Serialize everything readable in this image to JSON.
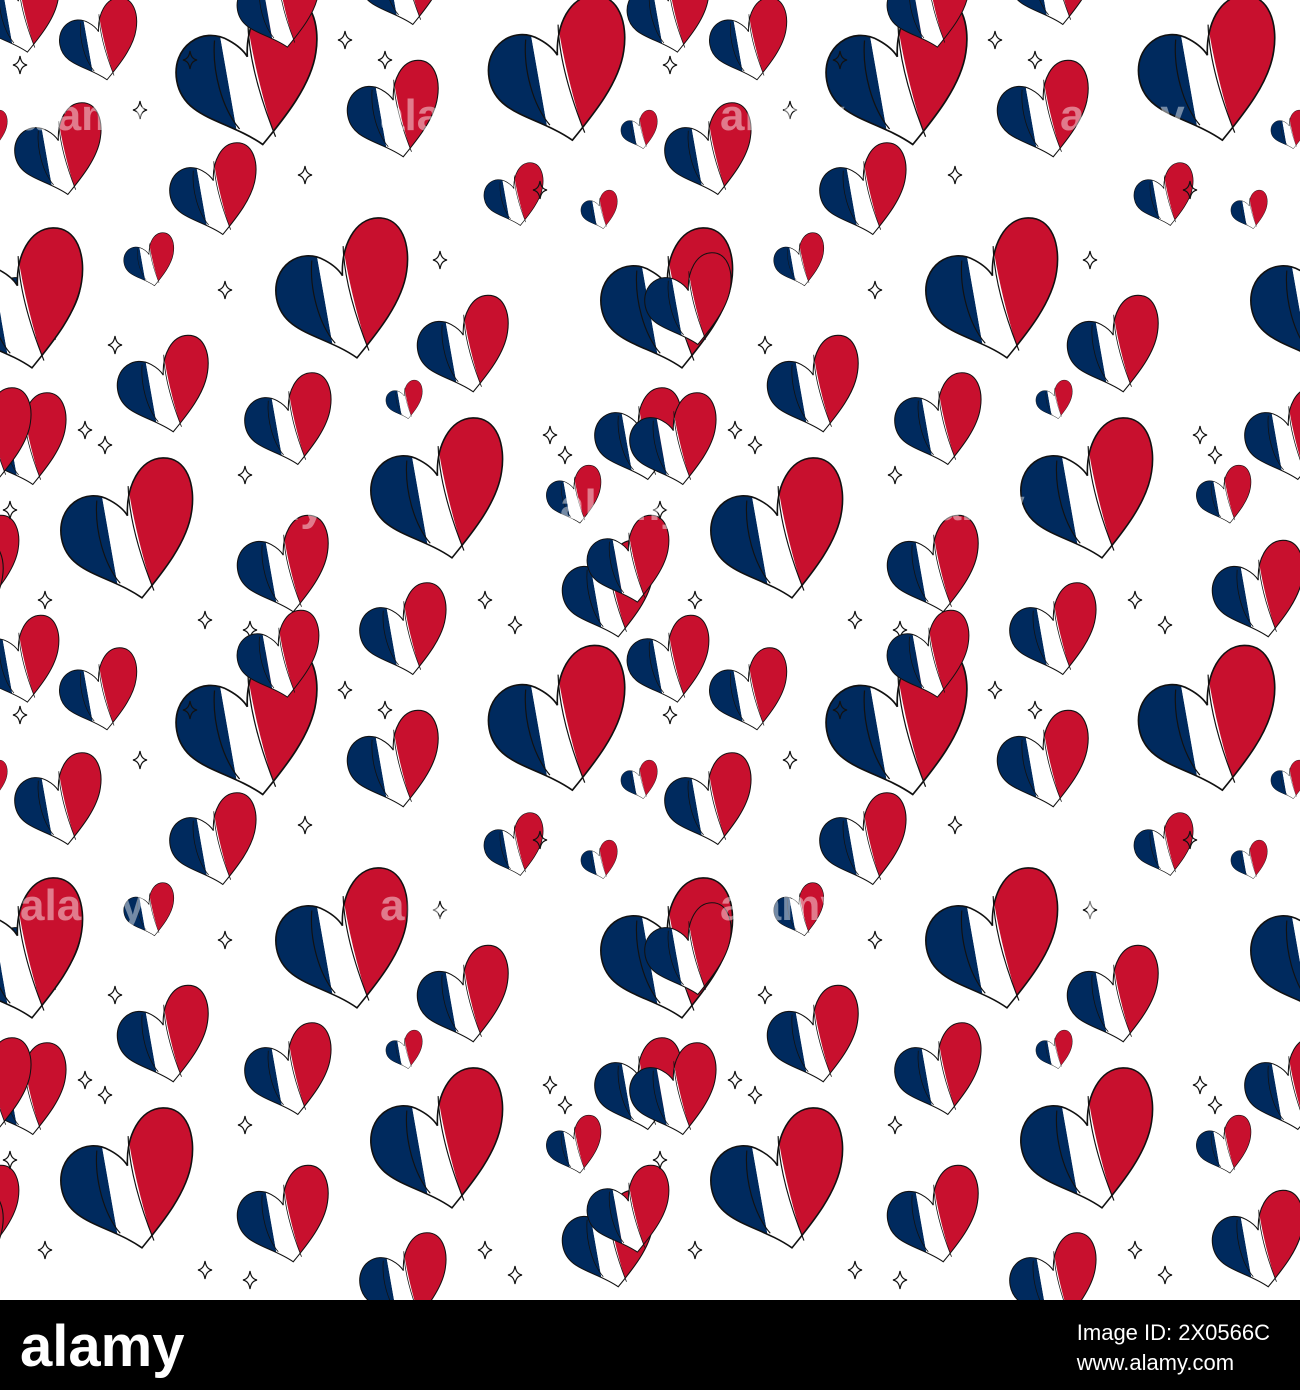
{
  "pattern": {
    "colors": {
      "blue": "#002A5E",
      "white": "#FFFFFF",
      "red": "#C8102E",
      "outline": "#111111"
    },
    "motifs": [
      "french-flag-heart-icon",
      "sparkle-icon"
    ]
  },
  "watermark": {
    "brand": "alamy",
    "image_id_label": "Image ID: 2X0566C",
    "site": "www.alamy.com"
  }
}
